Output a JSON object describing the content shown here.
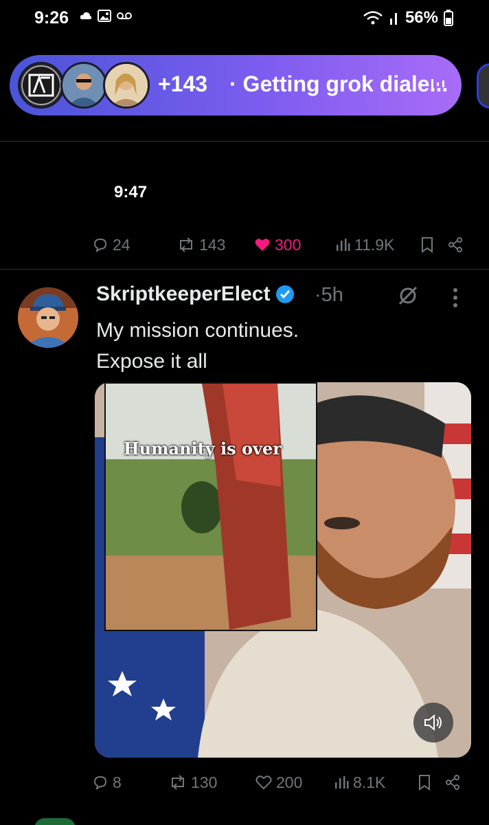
{
  "status_bar": {
    "time": "9:26",
    "battery": "56%"
  },
  "spaces_bar": {
    "listener_count": "+143",
    "separator": "·",
    "title": "Getting grok diale...",
    "gradient_colors": [
      "#4a55d8",
      "#a86cf7"
    ]
  },
  "prev_tweet": {
    "time": "9:47",
    "replies": "24",
    "reposts": "143",
    "likes": "300",
    "views": "11.9K",
    "like_color": "#f91880"
  },
  "post": {
    "author_name": "SkriptkeeperElect",
    "verified": true,
    "separator": "·",
    "age": "5h",
    "text_line1": "My mission continues.",
    "text_line2": "Expose it all",
    "media": {
      "inset_caption": "Humanity is over"
    },
    "replies": "8",
    "reposts": "130",
    "likes": "200",
    "views": "8.1K"
  }
}
